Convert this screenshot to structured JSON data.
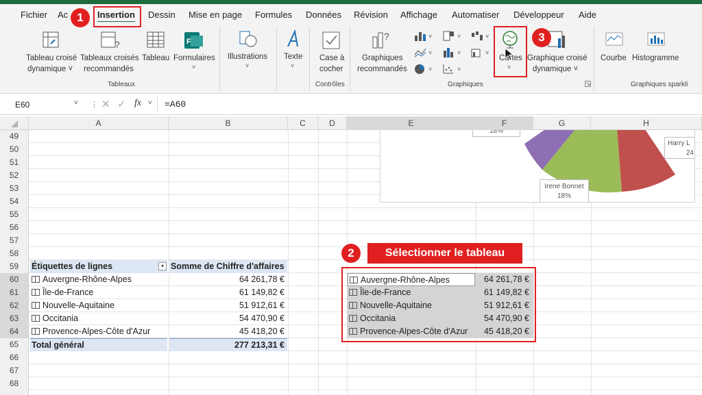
{
  "menu": {
    "items": [
      "Fichier",
      "Ac",
      "Insertion",
      "Dessin",
      "Mise en page",
      "Formules",
      "Données",
      "Révision",
      "Affichage",
      "Automatiser",
      "Développeur",
      "Aide"
    ],
    "active": "Insertion"
  },
  "ribbon": {
    "tableaux": {
      "group_label": "Tableaux",
      "btn1": {
        "line1": "Tableau croisé",
        "line2": "dynamique ˅"
      },
      "btn2": {
        "line1": "Tableaux croisés",
        "line2": "recommandés"
      },
      "btn3": "Tableau",
      "btn4": "Formulaires"
    },
    "illustrations": "Illustrations",
    "texte": "Texte",
    "controles": {
      "group_label": "Contrôles",
      "line1": "Case à",
      "line2": "cocher"
    },
    "graphiques": {
      "group_label": "Graphiques",
      "recommandes": {
        "line1": "Graphiques",
        "line2": "recommandés"
      },
      "cartes": "Cartes",
      "pivot": {
        "line1": "Graphique croisé",
        "line2": "dynamique ˅"
      }
    },
    "sparklines": {
      "group_label": "Graphiques sparkli",
      "courbe": "Courbe",
      "histogramme": "Histogramme"
    }
  },
  "formula_bar": {
    "name_box": "E60",
    "formula": "=A60",
    "fx": "fx"
  },
  "columns": [
    "A",
    "B",
    "C",
    "D",
    "E",
    "F",
    "G",
    "H"
  ],
  "rows": [
    "49",
    "50",
    "51",
    "52",
    "53",
    "54",
    "55",
    "56",
    "57",
    "58",
    "59",
    "60",
    "61",
    "62",
    "63",
    "64",
    "65",
    "66",
    "67",
    "68",
    "69"
  ],
  "pivot": {
    "header_labels": "Étiquettes de lignes",
    "header_sum": "Somme de Chiffre d'affaires",
    "rows": [
      {
        "label": "Auvergne-Rhône-Alpes",
        "value": "64 261,78 €"
      },
      {
        "label": "Île-de-France",
        "value": "61 149,82 €"
      },
      {
        "label": "Nouvelle-Aquitaine",
        "value": "51 912,61 €"
      },
      {
        "label": "Occitania",
        "value": "54 470,90 €"
      },
      {
        "label": "Provence-Alpes-Côte d'Azur",
        "value": "45 418,20 €"
      }
    ],
    "total_label": "Total général",
    "total_value": "277 213,31 €"
  },
  "pie": {
    "label_top": "18%",
    "label_irene_name": "Irene Bonnet",
    "label_irene_pct": "18%",
    "label_harry_name": "Harry L",
    "label_harry_pct": "24",
    "colors": {
      "purple": "#8f6fb3",
      "green": "#9bbb59",
      "red": "#c0504d"
    }
  },
  "annotations": {
    "badge1": "1",
    "badge2": "2",
    "badge3": "3",
    "step2_text": "Sélectionner le tableau",
    "accent": "#e02020"
  }
}
